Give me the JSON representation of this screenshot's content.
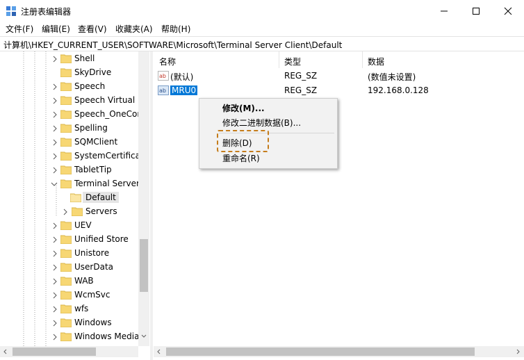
{
  "window": {
    "title": "注册表编辑器",
    "icon": "regedit-icon",
    "controls": [
      "minimize-icon",
      "maximize-icon",
      "close-icon"
    ]
  },
  "menu": [
    "文件(F)",
    "编辑(E)",
    "查看(V)",
    "收藏夹(A)",
    "帮助(H)"
  ],
  "address": "计算机\\HKEY_CURRENT_USER\\SOFTWARE\\Microsoft\\Terminal Server Client\\Default",
  "tree": [
    {
      "label": "Shell",
      "expander": "collapsed"
    },
    {
      "label": "SkyDrive",
      "expander": "none"
    },
    {
      "label": "Speech",
      "expander": "collapsed"
    },
    {
      "label": "Speech Virtual",
      "expander": "collapsed"
    },
    {
      "label": "Speech_OneCor",
      "expander": "collapsed"
    },
    {
      "label": "Spelling",
      "expander": "collapsed"
    },
    {
      "label": "SQMClient",
      "expander": "collapsed"
    },
    {
      "label": "SystemCertificat",
      "expander": "collapsed"
    },
    {
      "label": "TabletTip",
      "expander": "collapsed"
    },
    {
      "label": "Terminal Server",
      "expander": "expanded"
    },
    {
      "label": "Default",
      "expander": "none",
      "selected": true,
      "child": true
    },
    {
      "label": "Servers",
      "expander": "collapsed",
      "child": true
    },
    {
      "label": "UEV",
      "expander": "collapsed"
    },
    {
      "label": "Unified Store",
      "expander": "collapsed"
    },
    {
      "label": "Unistore",
      "expander": "collapsed"
    },
    {
      "label": "UserData",
      "expander": "collapsed"
    },
    {
      "label": "WAB",
      "expander": "collapsed"
    },
    {
      "label": "WcmSvc",
      "expander": "collapsed"
    },
    {
      "label": "wfs",
      "expander": "collapsed"
    },
    {
      "label": "Windows",
      "expander": "collapsed"
    },
    {
      "label": "Windows Media",
      "expander": "collapsed"
    }
  ],
  "list": {
    "headers": [
      "名称",
      "类型",
      "数据"
    ],
    "rows": [
      {
        "icon": "string-value-icon",
        "name": "(默认)",
        "type": "REG_SZ",
        "data": "(数值未设置)"
      },
      {
        "icon": "string-value-icon",
        "name": "MRU0",
        "type": "REG_SZ",
        "data": "192.168.0.128",
        "selected": true
      }
    ]
  },
  "context_menu": {
    "items": [
      "修改(M)...",
      "修改二进制数据(B)...",
      "删除(D)",
      "重命名(R)"
    ],
    "highlighted": "删除(D)"
  },
  "colors": {
    "selection": "#0078d7",
    "folder": "#f7d774",
    "highlight_border": "#c57c1b"
  }
}
